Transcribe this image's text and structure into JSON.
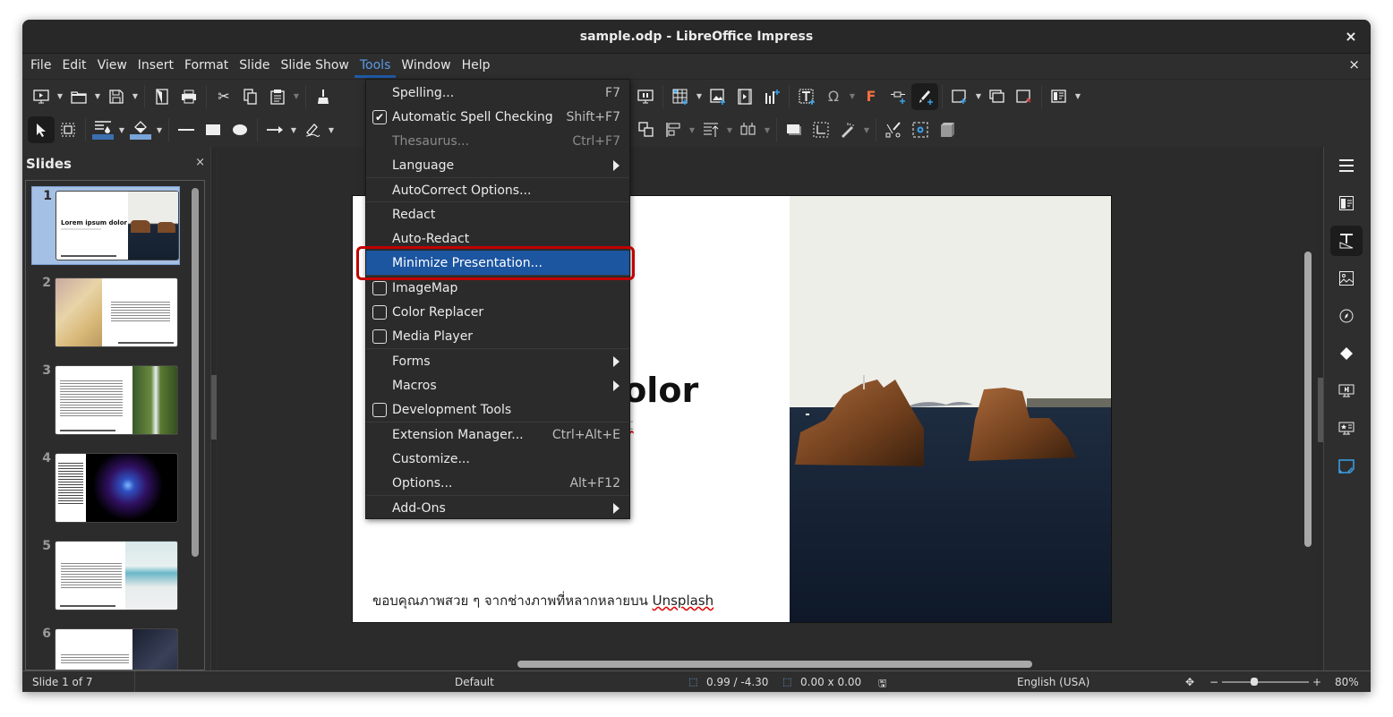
{
  "window": {
    "title": "sample.odp - LibreOffice Impress",
    "close": "×",
    "doc_close": "×"
  },
  "menubar": [
    "File",
    "Edit",
    "View",
    "Insert",
    "Format",
    "Slide",
    "Slide Show",
    "Tools",
    "Window",
    "Help"
  ],
  "menubar_active": "Tools",
  "tools_menu": {
    "items": [
      {
        "label": "Spelling...",
        "accel": "F7"
      },
      {
        "label": "Automatic Spell Checking",
        "accel": "Shift+F7",
        "check": true
      },
      {
        "label": "Thesaurus...",
        "accel": "Ctrl+F7",
        "disabled": true
      },
      {
        "label": "Language",
        "submenu": true
      },
      {
        "label": "AutoCorrect Options..."
      },
      {
        "label": "Redact"
      },
      {
        "label": "Auto-Redact"
      },
      {
        "label": "Minimize Presentation...",
        "highlighted": true
      },
      {
        "label": "ImageMap",
        "check": false
      },
      {
        "label": "Color Replacer",
        "check": false
      },
      {
        "label": "Media Player",
        "check": false
      },
      {
        "label": "Forms",
        "submenu": true
      },
      {
        "label": "Macros",
        "submenu": true
      },
      {
        "label": "Development Tools",
        "check": false
      },
      {
        "label": "Extension Manager...",
        "accel": "Ctrl+Alt+E"
      },
      {
        "label": "Customize..."
      },
      {
        "label": "Options...",
        "accel": "Alt+F12"
      },
      {
        "label": "Add-Ons",
        "submenu": true
      }
    ]
  },
  "slides_panel": {
    "title": "Slides",
    "close": "×",
    "thumbs": [
      {
        "num": "1",
        "title": "Lorem ipsum dolor",
        "selected": true
      },
      {
        "num": "2"
      },
      {
        "num": "3"
      },
      {
        "num": "4"
      },
      {
        "num": "5"
      },
      {
        "num": "6"
      }
    ]
  },
  "slide": {
    "title_visible": "dolor",
    "title_full": "Lorem ipsum dolor",
    "subtitle_visible": "elit",
    "footer_thai": "ขอบคุณภาพสวย ๆ จากช่างภาพที่หลากหลายบน ",
    "footer_link": "Unsplash"
  },
  "statusbar": {
    "slide_info": "Slide 1 of 7",
    "layout": "Default",
    "position": "0.99 / -4.30",
    "size": "0.00 x 0.00",
    "language": "English (USA)",
    "zoom_minus": "−",
    "zoom_plus": "+",
    "zoom": "80%",
    "zoom_level_percent": 80
  },
  "colors": {
    "accent": "#1c55a0",
    "highlight_box": "#c00000",
    "selected_thumb": "#a4c0e4"
  }
}
